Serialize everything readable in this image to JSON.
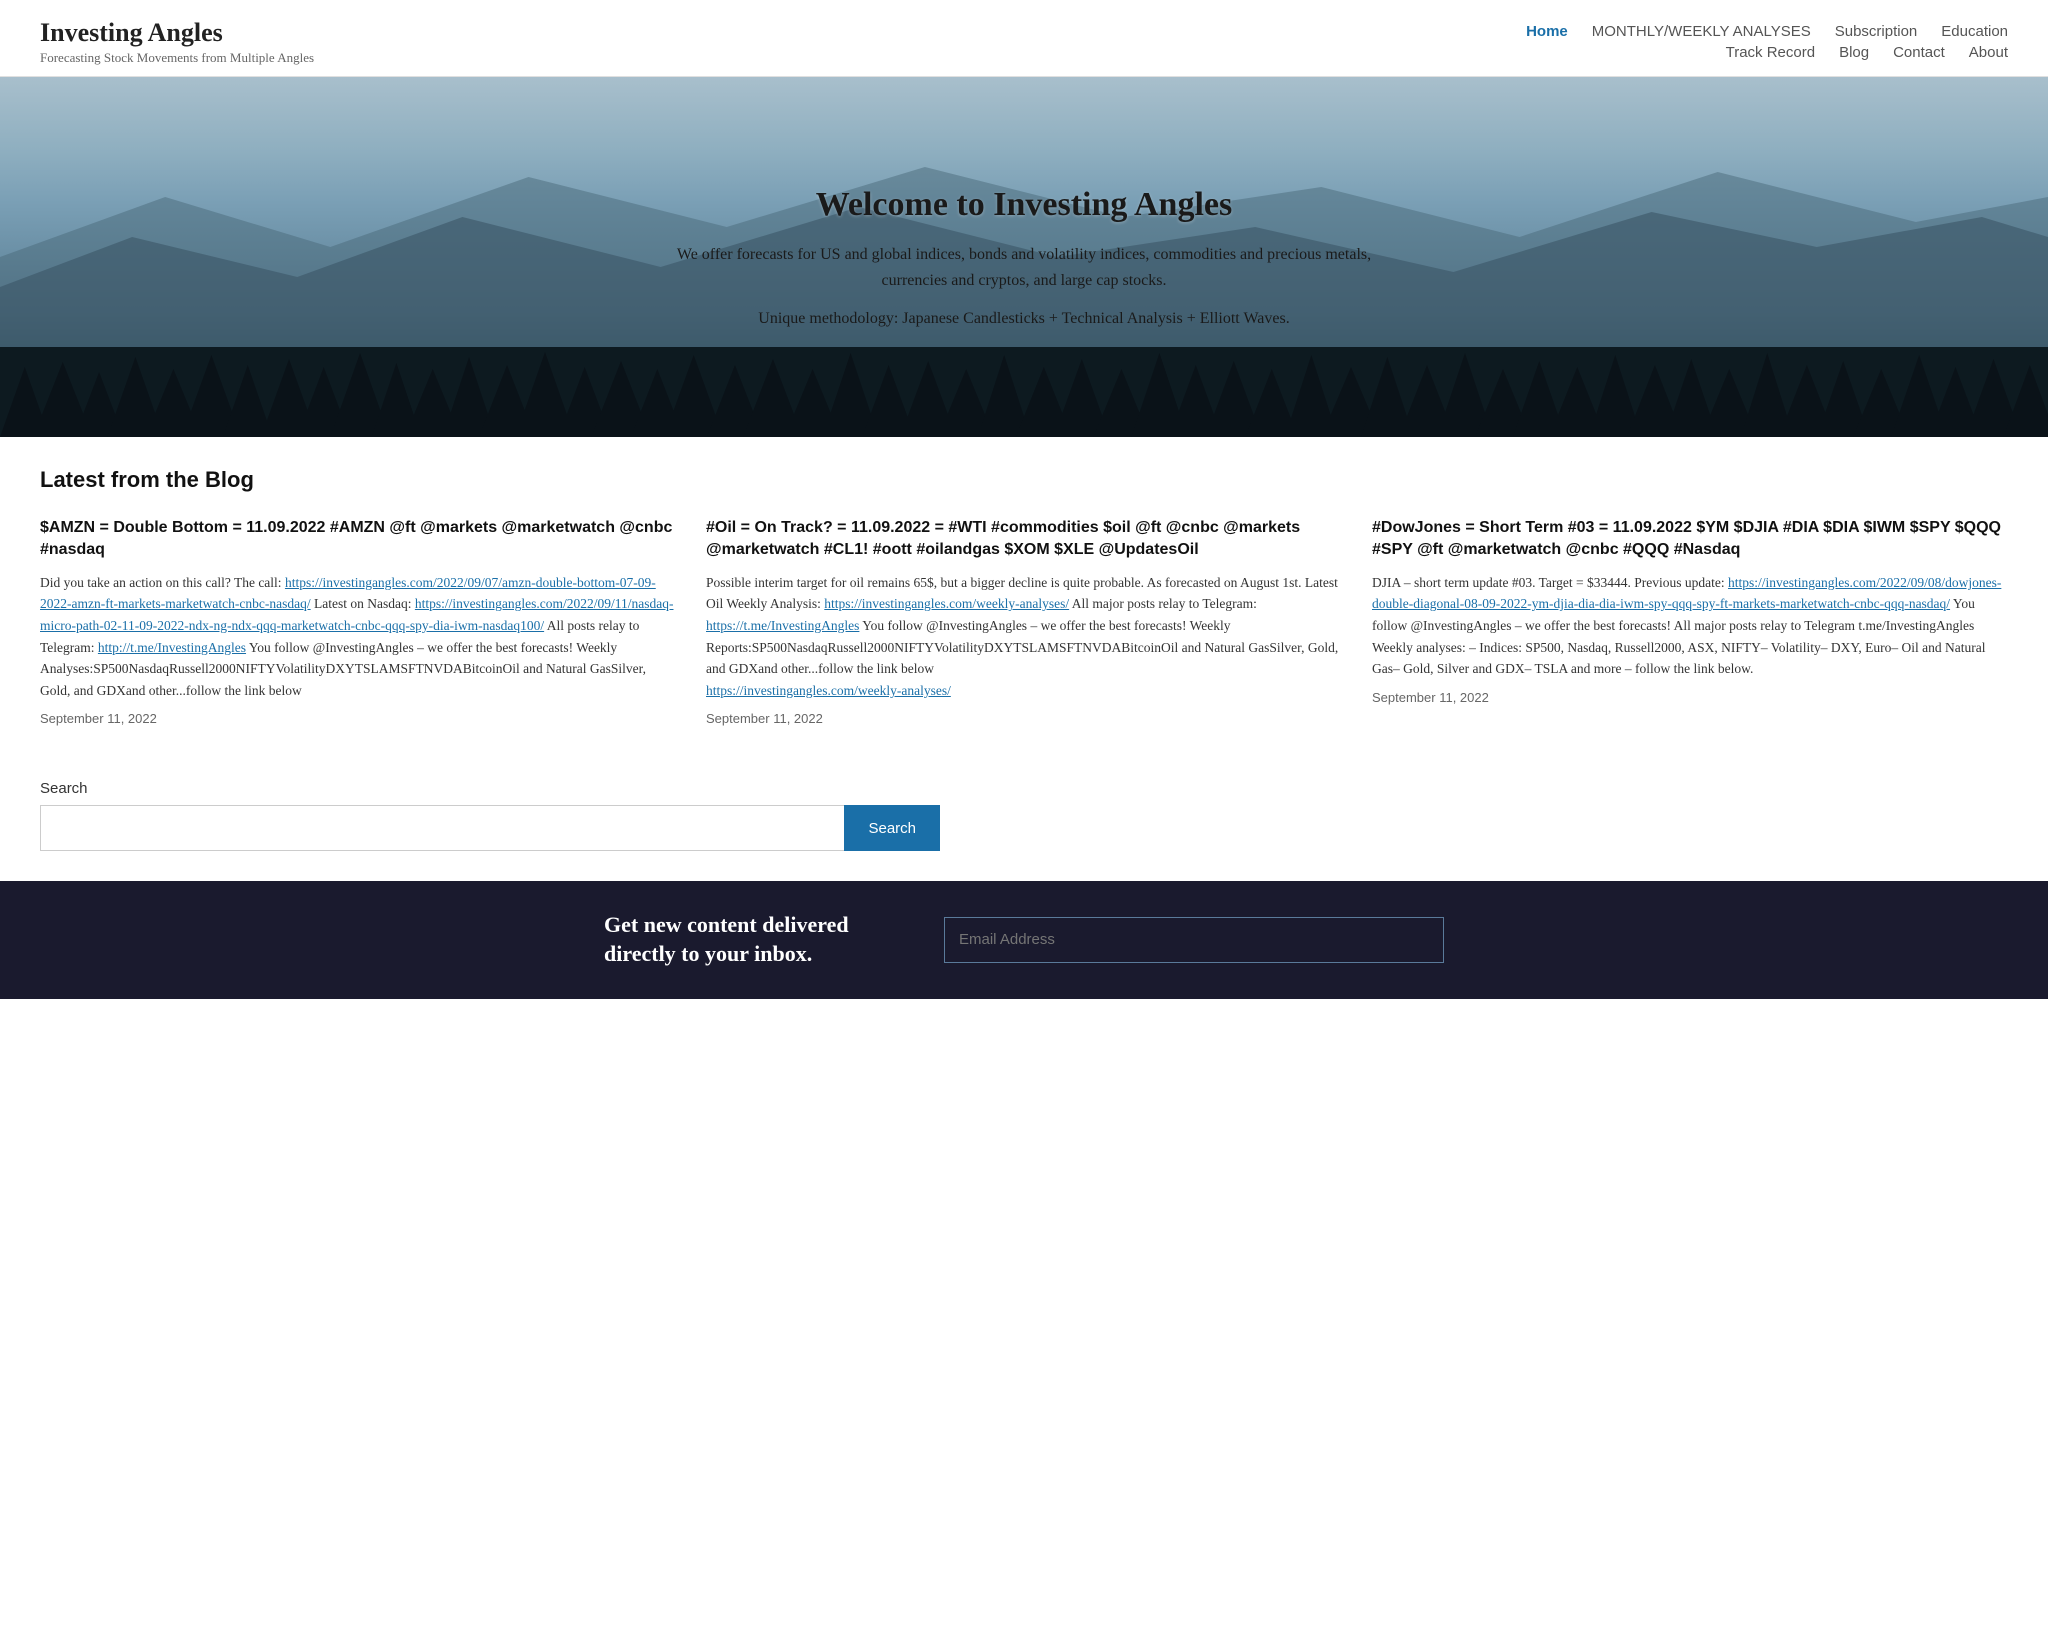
{
  "site": {
    "title": "Investing Angles",
    "tagline": "Forecasting Stock Movements from Multiple Angles"
  },
  "nav": {
    "row1": [
      {
        "label": "Home",
        "active": true
      },
      {
        "label": "MONTHLY/WEEKLY ANALYSES",
        "active": false
      },
      {
        "label": "Subscription",
        "active": false
      },
      {
        "label": "Education",
        "active": false
      }
    ],
    "row2": [
      {
        "label": "Track Record",
        "active": false
      },
      {
        "label": "Blog",
        "active": false
      },
      {
        "label": "Contact",
        "active": false
      },
      {
        "label": "About",
        "active": false
      }
    ]
  },
  "hero": {
    "title": "Welcome to Investing Angles",
    "subtitle": "We offer forecasts for US and global indices, bonds and volatility indices, commodities and precious metals, currencies and cryptos, and large cap stocks.",
    "methodology": "Unique methodology: Japanese Candlesticks + Technical Analysis + Elliott Waves."
  },
  "blog": {
    "section_title": "Latest from the Blog",
    "posts": [
      {
        "title": "$AMZN = Double Bottom = 11.09.2022 #AMZN @ft @markets @marketwatch @cnbc #nasdaq",
        "body": "Did you take an action on this call? The call: ",
        "link1": "https://investingangles.com/2022/09/07/amzn-double-bottom-07-09-2022-amzn-ft-markets-marketwatch-cnbc-nasdaq/",
        "link1_text": "https://investingangles.com/2022/09/07/amzn-double-bottom-07-09-2022-amzn-ft-markets-marketwatch-cnbc-nasdaq/",
        "mid_text": " Latest on Nasdaq:",
        "link2": "https://investingangles.com/2022/09/11/nasdaq-micro-path-02-11-09-2022-ndx-ng-ndx-qqq-marketwatch-cnbc-qqq-spy-dia-iwm-nasdaq100/",
        "link2_text": "https://investingangles.com/2022/09/11/nasdaq-micro-path-02-11-09-2022-ndx-ng-ndx-qqq-marketwatch-cnbc-qqq-spy-dia-iwm-nasdaq100/",
        "end_text": " All posts relay to Telegram: ",
        "link3": "http://t.me/InvestingAngles",
        "link3_text": "http://t.me/InvestingAngles",
        "after_link3": " You follow @InvestingAngles – we offer the best forecasts! Weekly Analyses:SP500NasdaqRussell2000NIFTYVolatilityDXYTSLAMSFTNVDABitcoinOil and Natural GasSilver, Gold, and GDXand other...follow the link below",
        "date": "September 11, 2022"
      },
      {
        "title": "#Oil = On Track? = 11.09.2022 = #WTI #commodities $oil @ft @cnbc @markets @marketwatch #CL1! #oott #oilandgas $XOM $XLE @UpdatesOil",
        "body": "Possible interim target for oil remains 65$, but a bigger decline is quite probable. As forecasted on August 1st. Latest Oil Weekly Analysis:",
        "link1": "https://investingangles.com/weekly-analyses/",
        "link1_text": "https://investingangles.com/weekly-analyses/",
        "mid_text": " All major posts relay to Telegram: ",
        "link2": "https://t.me/InvestingAngles",
        "link2_text": "https://t.me/InvestingAngles",
        "end_text": " You follow @InvestingAngles – we offer the best forecasts! Weekly Reports:SP500NasdaqRussell2000NIFTYVolatilityDXYTSLAMSFTNVDABitcoinOil and Natural GasSilver, Gold, and GDXand other...follow the link below",
        "link3": "https://investingangles.com/weekly-analyses/",
        "link3_text": "https://investingangles.com/weekly-analyses/",
        "date": "September 11, 2022"
      },
      {
        "title": "#DowJones = Short Term #03 = 11.09.2022 $YM $DJIA #DIA $DIA $IWM $SPY $QQQ #SPY @ft @marketwatch @cnbc #QQQ #Nasdaq",
        "body": "DJIA – short term update #03. Target = $33444. Previous update:",
        "link1": "https://investingangles.com/2022/09/08/dowjones-double-diagonal-08-09-2022-ym-djia-dia-dia-iwm-spy-qqq-spy-ft-markets-marketwatch-cnbc-qqq-nasdaq/",
        "link1_text": "https://investingangles.com/2022/09/08/dowjones-double-diagonal-08-09-2022-ym-djia-dia-dia-iwm-spy-qqq-spy-ft-markets-marketwatch-cnbc-qqq-nasdaq/",
        "end_text": " You follow @InvestingAngles – we offer the best forecasts! All major posts relay to Telegram t.me/InvestingAngles Weekly analyses: – Indices: SP500, Nasdaq, Russell2000, ASX, NIFTY– Volatility– DXY, Euro– Oil and Natural Gas– Gold, Silver and GDX– TSLA and more – follow the link below.",
        "date": "September 11, 2022"
      }
    ]
  },
  "search": {
    "label": "Search",
    "placeholder": "",
    "button_label": "Search"
  },
  "footer_cta": {
    "text": "Get new content delivered directly to your inbox.",
    "email_placeholder": "Email Address"
  }
}
